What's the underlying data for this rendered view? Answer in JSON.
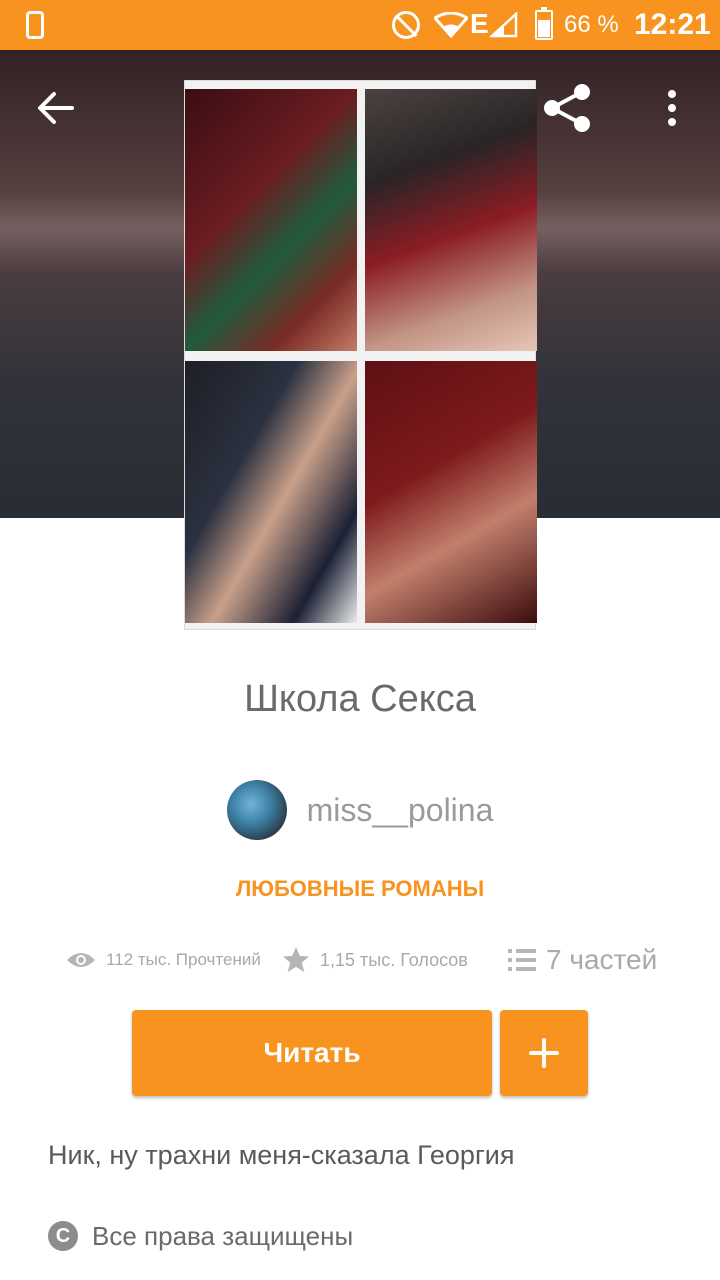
{
  "status_bar": {
    "battery_percent": "66 %",
    "time": "12:21",
    "network_type": "E",
    "battery_level": 0.66,
    "icons": [
      "phone-icon",
      "do-not-disturb-icon",
      "wifi-icon",
      "signal-icon",
      "battery-icon"
    ]
  },
  "toolbar": {
    "icons": [
      "back-arrow-icon",
      "share-icon",
      "more-vert-icon"
    ]
  },
  "story": {
    "title": "Школа Секса",
    "author": "miss__polina",
    "genre": "ЛЮБОВНЫЕ РОМАНЫ",
    "reads": "112 тыс. Прочтений",
    "votes": "1,15 тыс. Голосов",
    "parts": "7 частей",
    "description": "Ник, ну трахни меня-сказала Георгия",
    "copyright": "Все права защищены"
  },
  "actions": {
    "read_label": "Читать",
    "add_icon": "plus-icon"
  },
  "colors": {
    "accent": "#f7931e",
    "status_bar": "#f7931e",
    "text_muted": "#a9a9a9"
  }
}
